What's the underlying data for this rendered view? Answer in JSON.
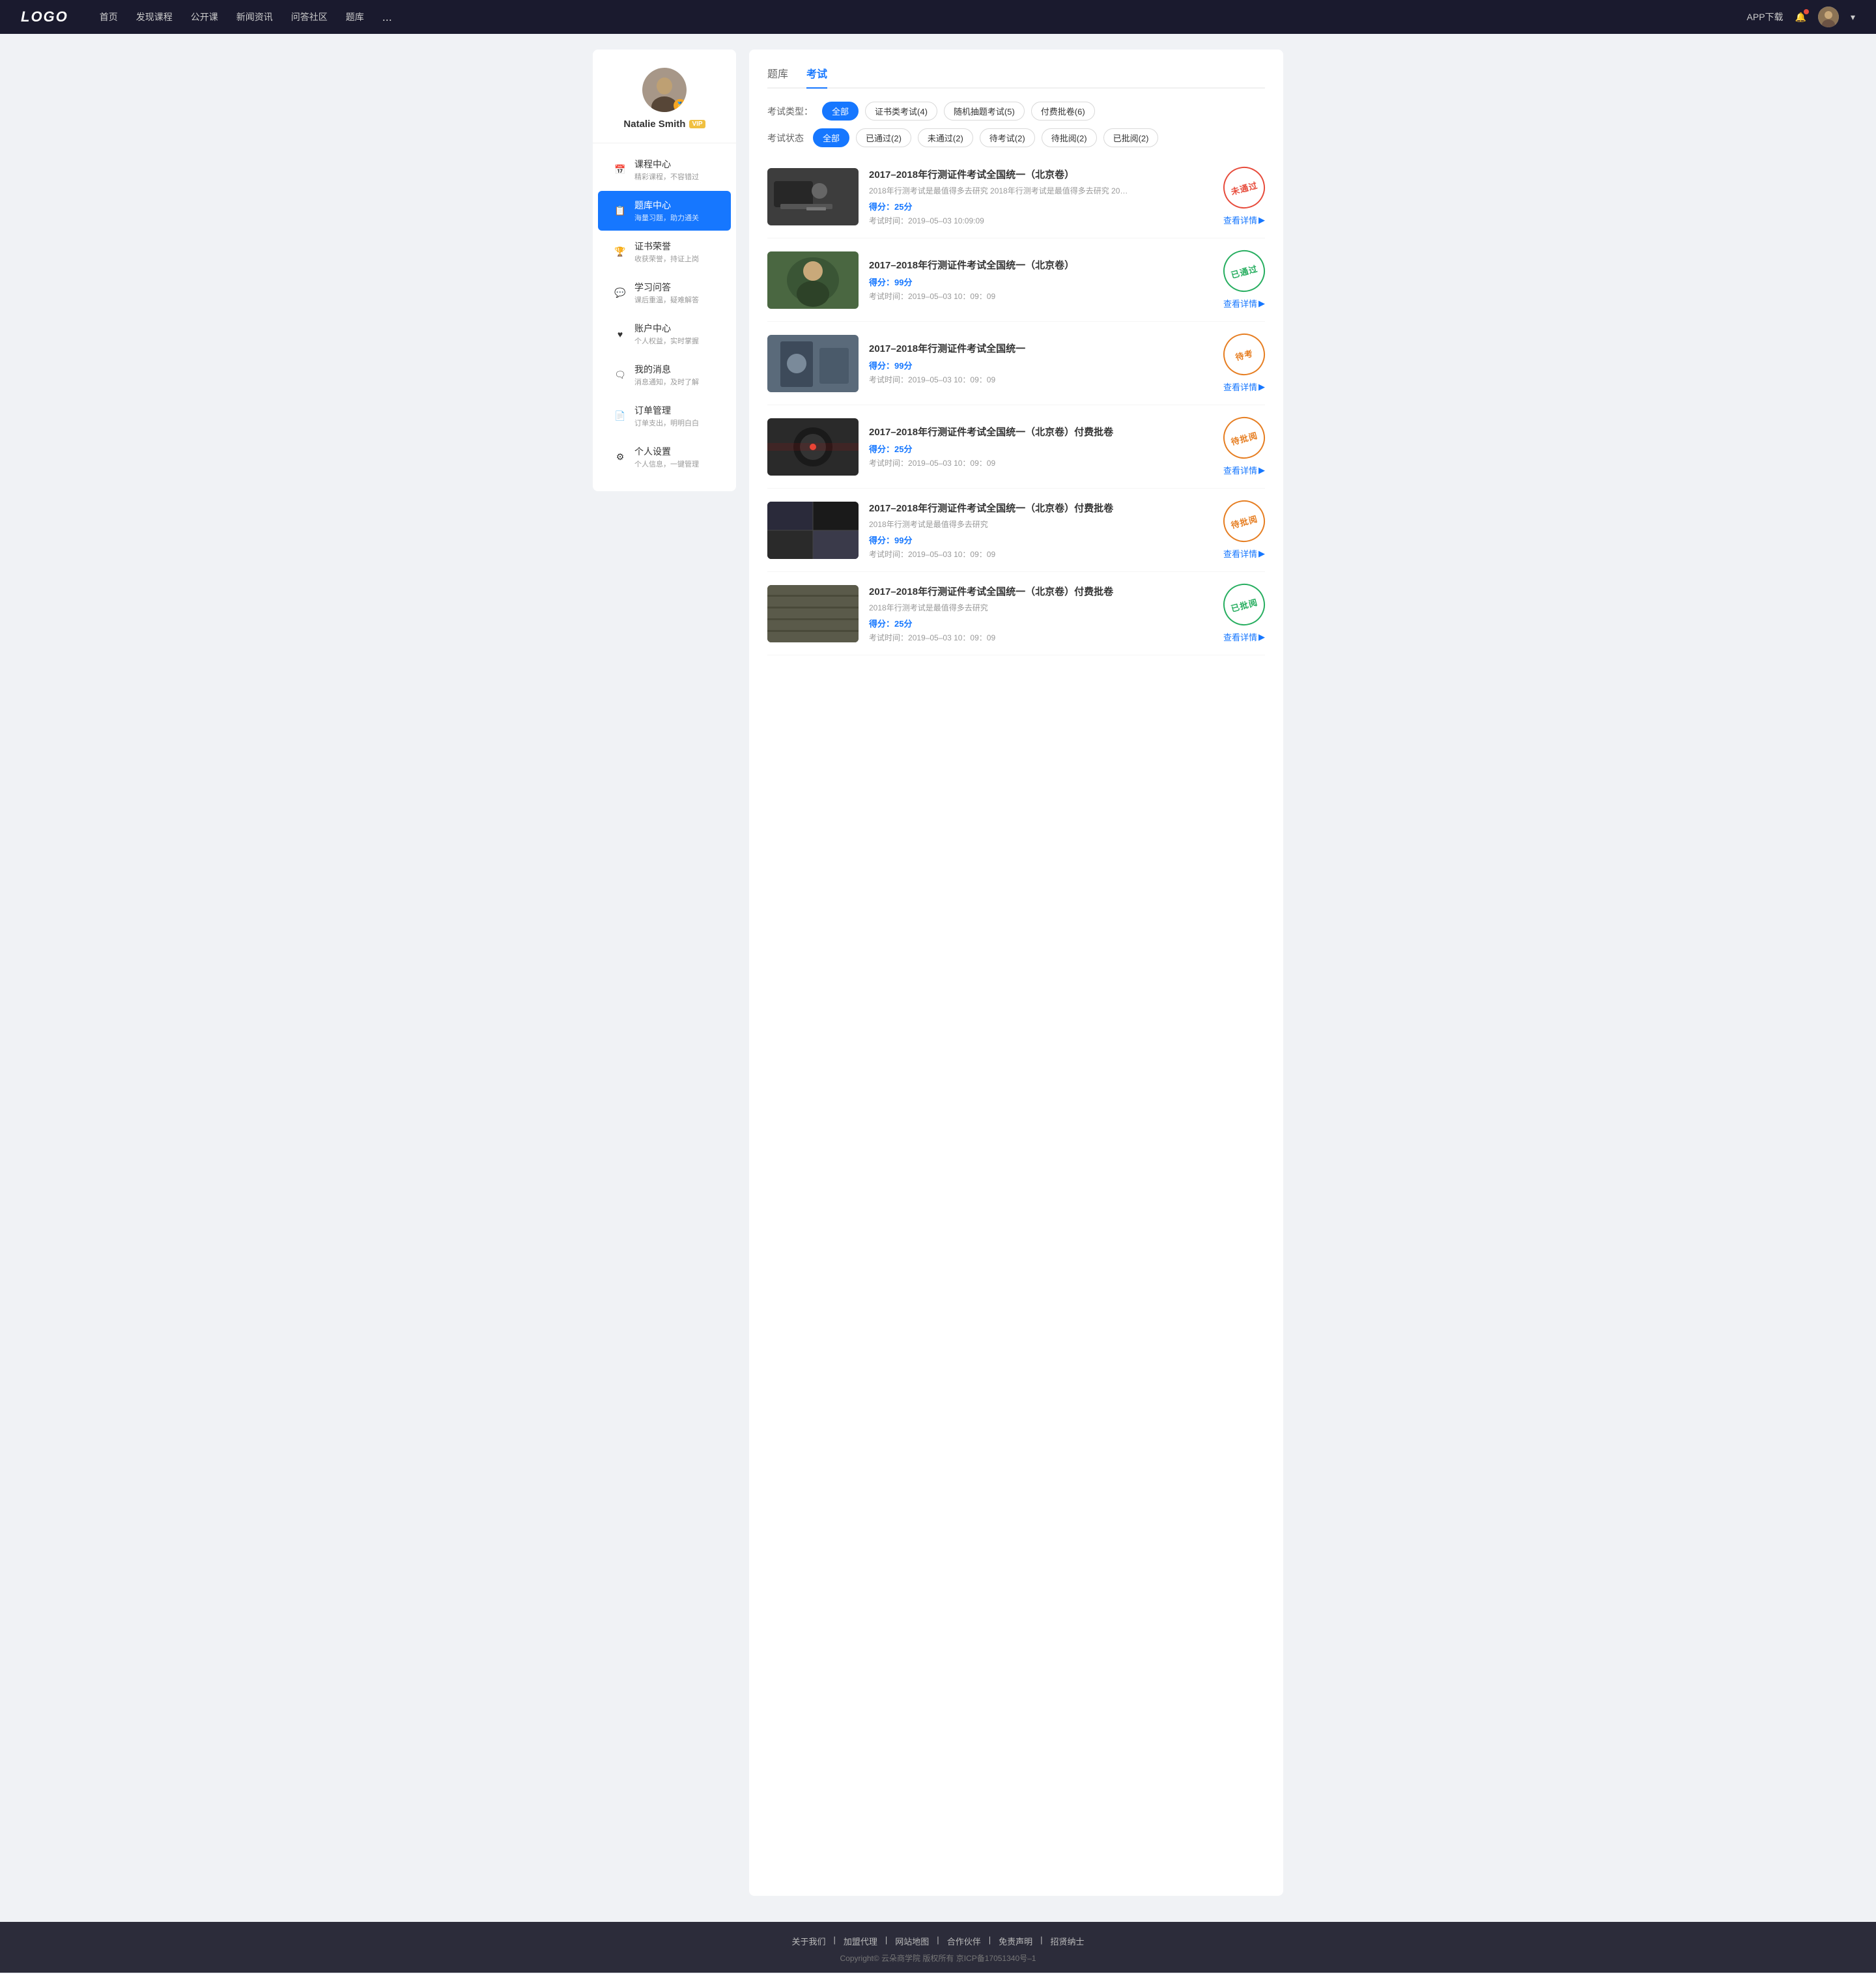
{
  "logo": "LOGO",
  "navbar": {
    "items": [
      "首页",
      "发现课程",
      "公开课",
      "新闻资讯",
      "问答社区",
      "题库"
    ],
    "more": "...",
    "app_download": "APP下载"
  },
  "sidebar": {
    "username": "Natalie Smith",
    "vip_label": "VIP",
    "menu": [
      {
        "id": "course-center",
        "icon": "📅",
        "title": "课程中心",
        "sub": "精彩课程，不容错过",
        "active": false
      },
      {
        "id": "exam-bank",
        "icon": "📋",
        "title": "题库中心",
        "sub": "海量习题，助力通关",
        "active": true
      },
      {
        "id": "certificate",
        "icon": "🏆",
        "title": "证书荣誉",
        "sub": "收获荣誉，持证上岗",
        "active": false
      },
      {
        "id": "qa",
        "icon": "💬",
        "title": "学习问答",
        "sub": "课后重温，疑难解答",
        "active": false
      },
      {
        "id": "account",
        "icon": "❤",
        "title": "账户中心",
        "sub": "个人权益，实时掌握",
        "active": false
      },
      {
        "id": "messages",
        "icon": "🗨",
        "title": "我的消息",
        "sub": "消息通知，及时了解",
        "active": false
      },
      {
        "id": "orders",
        "icon": "📄",
        "title": "订单管理",
        "sub": "订单支出，明明白白",
        "active": false
      },
      {
        "id": "settings",
        "icon": "⚙",
        "title": "个人设置",
        "sub": "个人信息，一键管理",
        "active": false
      }
    ]
  },
  "content": {
    "tabs": [
      {
        "label": "题库",
        "active": false
      },
      {
        "label": "考试",
        "active": true
      }
    ],
    "exam_type_label": "考试类型：",
    "exam_type_filters": [
      {
        "label": "全部",
        "active": true
      },
      {
        "label": "证书类考试(4)",
        "active": false
      },
      {
        "label": "随机抽题考试(5)",
        "active": false
      },
      {
        "label": "付费批卷(6)",
        "active": false
      }
    ],
    "exam_status_label": "考试状态",
    "exam_status_filters": [
      {
        "label": "全部",
        "active": true
      },
      {
        "label": "已通过(2)",
        "active": false
      },
      {
        "label": "未通过(2)",
        "active": false
      },
      {
        "label": "待考试(2)",
        "active": false
      },
      {
        "label": "待批阅(2)",
        "active": false
      },
      {
        "label": "已批阅(2)",
        "active": false
      }
    ],
    "exams": [
      {
        "id": 1,
        "title": "2017–2018年行测证件考试全国统一（北京卷）",
        "desc": "2018年行测考试是最值得多去研究 2018年行测考试是最值得多去研究 2018年行...",
        "score_label": "得分：",
        "score": "25",
        "score_unit": "分",
        "time_label": "考试时间：",
        "time": "2019–05–03  10:09:09",
        "status": "未通过",
        "status_type": "failed",
        "action": "查看详情"
      },
      {
        "id": 2,
        "title": "2017–2018年行测证件考试全国统一（北京卷）",
        "desc": "",
        "score_label": "得分：",
        "score": "99",
        "score_unit": "分",
        "time_label": "考试时间：",
        "time": "2019–05–03  10：09：09",
        "status": "已通过",
        "status_type": "passed",
        "action": "查看详情"
      },
      {
        "id": 3,
        "title": "2017–2018年行测证件考试全国统一",
        "desc": "",
        "score_label": "得分：",
        "score": "99",
        "score_unit": "分",
        "time_label": "考试时间：",
        "time": "2019–05–03  10：09：09",
        "status": "待考",
        "status_type": "pending",
        "action": "查看详情"
      },
      {
        "id": 4,
        "title": "2017–2018年行测证件考试全国统一（北京卷）付费批卷",
        "desc": "",
        "score_label": "得分：",
        "score": "25",
        "score_unit": "分",
        "time_label": "考试时间：",
        "time": "2019–05–03  10：09：09",
        "status": "待批阅",
        "status_type": "review",
        "action": "查看详情"
      },
      {
        "id": 5,
        "title": "2017–2018年行测证件考试全国统一（北京卷）付费批卷",
        "desc": "2018年行测考试是最值得多去研究",
        "score_label": "得分：",
        "score": "99",
        "score_unit": "分",
        "time_label": "考试时间：",
        "time": "2019–05–03  10：09：09",
        "status": "待批阅",
        "status_type": "review",
        "action": "查看详情"
      },
      {
        "id": 6,
        "title": "2017–2018年行测证件考试全国统一（北京卷）付费批卷",
        "desc": "2018年行测考试是最值得多去研究",
        "score_label": "得分：",
        "score": "25",
        "score_unit": "分",
        "time_label": "考试时间：",
        "time": "2019–05–03  10：09：09",
        "status": "已批阅",
        "status_type": "reviewed",
        "action": "查看详情"
      }
    ]
  },
  "footer": {
    "links": [
      "关于我们",
      "加盟代理",
      "网站地图",
      "合作伙伴",
      "免责声明",
      "招贤纳士"
    ],
    "copyright": "Copyright© 云朵商学院  版权所有    京ICP备17051340号–1"
  }
}
